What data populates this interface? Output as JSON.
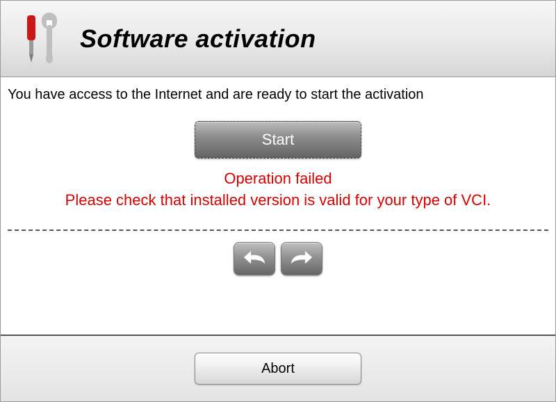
{
  "header": {
    "title": "Software activation"
  },
  "main": {
    "intro": "You have access to the Internet and are ready to start the activation",
    "start_label": "Start",
    "error_line1": "Operation failed",
    "error_line2": "Please check that installed version is valid for your type of VCI."
  },
  "footer": {
    "abort_label": "Abort"
  }
}
